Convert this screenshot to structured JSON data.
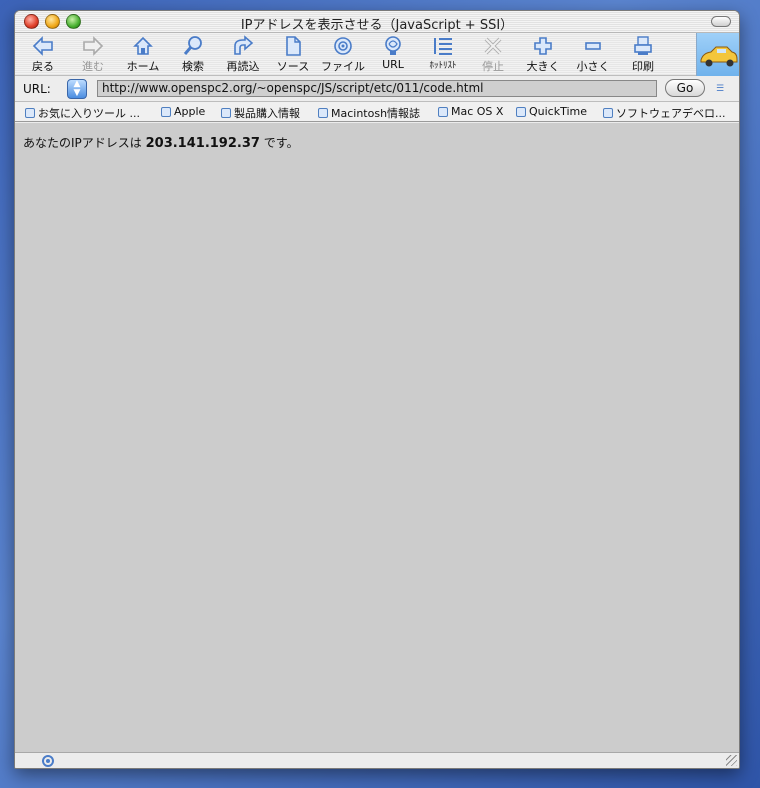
{
  "window": {
    "title": "IPアドレスを表示させる（JavaScript + SSI）"
  },
  "toolbar": {
    "buttons": [
      {
        "label": "戻る",
        "icon": "back-arrow-icon",
        "enabled": true
      },
      {
        "label": "進む",
        "icon": "forward-arrow-icon",
        "enabled": false
      },
      {
        "label": "ホーム",
        "icon": "home-icon",
        "enabled": true
      },
      {
        "label": "検索",
        "icon": "search-icon",
        "enabled": true
      },
      {
        "label": "再読込",
        "icon": "reload-icon",
        "enabled": true
      },
      {
        "label": "ソース",
        "icon": "source-icon",
        "enabled": true
      },
      {
        "label": "ファイル",
        "icon": "file-icon",
        "enabled": true
      },
      {
        "label": "URL",
        "icon": "url-icon",
        "enabled": true
      },
      {
        "label": "ﾎｯﾄﾘｽﾄ",
        "icon": "hotlist-icon",
        "enabled": true
      },
      {
        "label": "停止",
        "icon": "stop-icon",
        "enabled": false
      },
      {
        "label": "大きく",
        "icon": "plus-icon",
        "enabled": true
      },
      {
        "label": "小さく",
        "icon": "minus-icon",
        "enabled": true
      },
      {
        "label": "印刷",
        "icon": "print-icon",
        "enabled": true
      }
    ]
  },
  "urlbar": {
    "label": "URL:",
    "value": "http://www.openspc2.org/~openspc/JS/script/etc/011/code.html",
    "go_label": "Go"
  },
  "favorites": [
    "お気に入りツール ...",
    "Apple",
    "製品購入情報",
    "Macintosh情報誌",
    "Mac OS X",
    "QuickTime",
    "ソフトウェアデベロ..."
  ],
  "content": {
    "prefix": "あなたのIPアドレスは",
    "ip": "203.141.192.37",
    "suffix": "です。"
  },
  "colors": {
    "accent": "#4a7cc8",
    "content_bg": "#cccccc",
    "desktop": "#3c63b8"
  }
}
